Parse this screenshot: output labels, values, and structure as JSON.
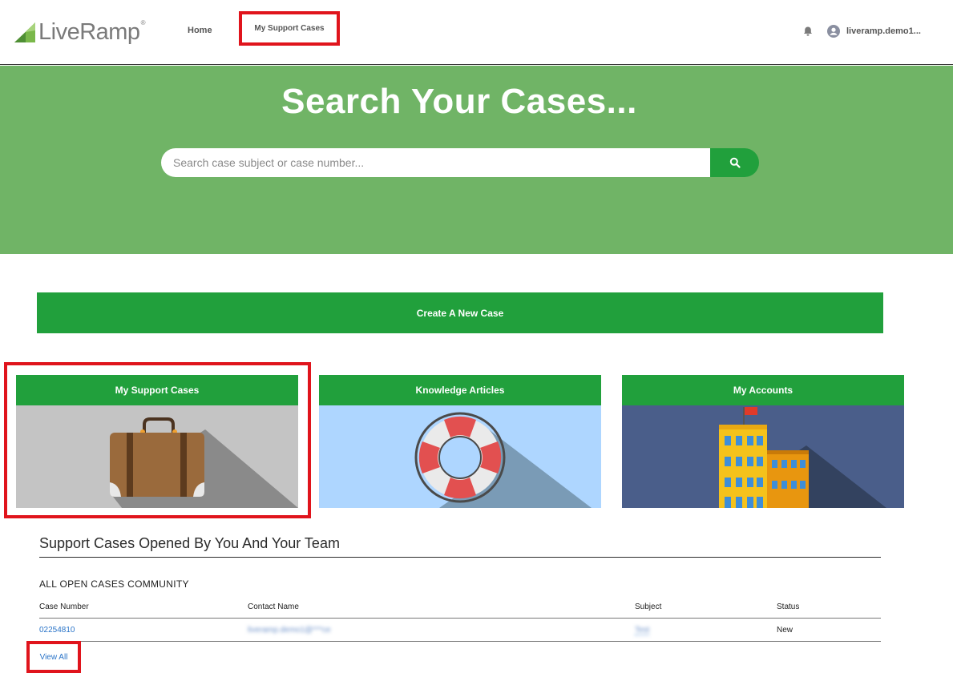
{
  "header": {
    "logo_text": "LiveRamp",
    "logo_reg": "®",
    "nav": {
      "home": "Home",
      "my_support_cases": "My Support Cases"
    },
    "user_name": "liveramp.demo1..."
  },
  "hero": {
    "title": "Search Your Cases...",
    "search_placeholder": "Search case subject or case number...",
    "search_value": ""
  },
  "create_case_label": "Create A New Case",
  "tiles": [
    {
      "label": "My Support Cases",
      "image": "briefcase-icon"
    },
    {
      "label": "Knowledge Articles",
      "image": "life-ring-icon"
    },
    {
      "label": "My Accounts",
      "image": "building-icon"
    }
  ],
  "cases_section": {
    "title": "Support Cases Opened By You And Your Team",
    "list_view_name": "ALL OPEN CASES COMMUNITY",
    "columns": [
      "Case Number",
      "Contact Name",
      "Subject",
      "Status"
    ],
    "rows": [
      {
        "case_number": "02254810",
        "contact_name": "liveramp.demo1@***ce",
        "subject": "Test",
        "status": "New"
      }
    ],
    "view_all": "View All"
  },
  "colors": {
    "brand_green": "#21a03c",
    "hero_green": "#70b466",
    "highlight_red": "#e0141c",
    "link_blue": "#2a74c8"
  }
}
